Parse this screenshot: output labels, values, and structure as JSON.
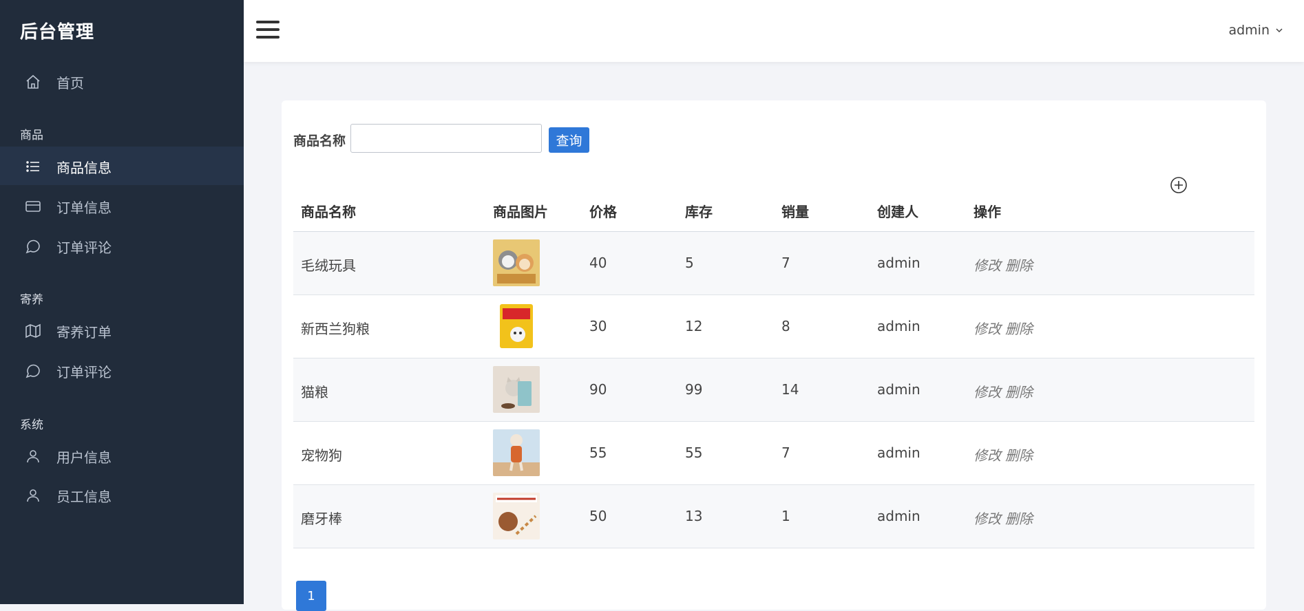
{
  "sidebar": {
    "brand": "后台管理",
    "home": "首页",
    "sections": [
      {
        "title": "商品",
        "items": [
          "商品信息",
          "订单信息",
          "订单评论"
        ]
      },
      {
        "title": "寄养",
        "items": [
          "寄养订单",
          "订单评论"
        ]
      },
      {
        "title": "系统",
        "items": [
          "用户信息",
          "员工信息"
        ]
      }
    ]
  },
  "header": {
    "user": "admin"
  },
  "search": {
    "label": "商品名称",
    "value": "",
    "button": "查询"
  },
  "table": {
    "columns": [
      "商品名称",
      "商品图片",
      "价格",
      "库存",
      "销量",
      "创建人",
      "操作"
    ],
    "rows": [
      {
        "name": "毛绒玩具",
        "price": "40",
        "stock": "5",
        "sales": "7",
        "creator": "admin",
        "edit": "修改",
        "del": "删除"
      },
      {
        "name": "新西兰狗粮",
        "price": "30",
        "stock": "12",
        "sales": "8",
        "creator": "admin",
        "edit": "修改",
        "del": "删除"
      },
      {
        "name": "猫粮",
        "price": "90",
        "stock": "99",
        "sales": "14",
        "creator": "admin",
        "edit": "修改",
        "del": "删除"
      },
      {
        "name": "宠物狗",
        "price": "55",
        "stock": "55",
        "sales": "7",
        "creator": "admin",
        "edit": "修改",
        "del": "删除"
      },
      {
        "name": "磨牙棒",
        "price": "50",
        "stock": "13",
        "sales": "1",
        "creator": "admin",
        "edit": "修改",
        "del": "删除"
      }
    ]
  },
  "pagination": {
    "current": "1"
  }
}
